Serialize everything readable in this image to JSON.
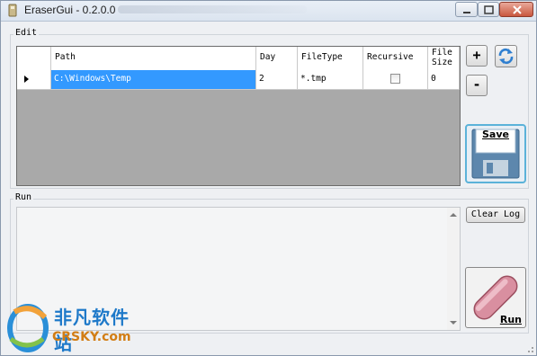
{
  "window": {
    "title": "EraserGui - 0.2.0.0"
  },
  "edit_group": {
    "label": "Edit"
  },
  "grid": {
    "columns": [
      "Path",
      "Day",
      "FileType",
      "Recursive",
      "File Size"
    ],
    "column_two_line": [
      "File",
      "Size"
    ],
    "rows": [
      {
        "path": "C:\\Windows\\Temp",
        "day": "2",
        "filetype": "*.tmp",
        "recursive": false,
        "file_size": "0"
      }
    ]
  },
  "buttons": {
    "add": "+",
    "remove": "-",
    "refresh_icon": "refresh-icon",
    "save": "Save",
    "clear_log": "Clear Log",
    "run": "Run"
  },
  "run_group": {
    "label": "Run"
  },
  "watermark": {
    "chinese": "非凡软件站",
    "english": "CRSKY.com"
  },
  "colors": {
    "selection": "#3399ff",
    "grid_empty": "#a9a9a9",
    "save_border": "#5bb2d9",
    "eraser": "#d98fa0"
  }
}
